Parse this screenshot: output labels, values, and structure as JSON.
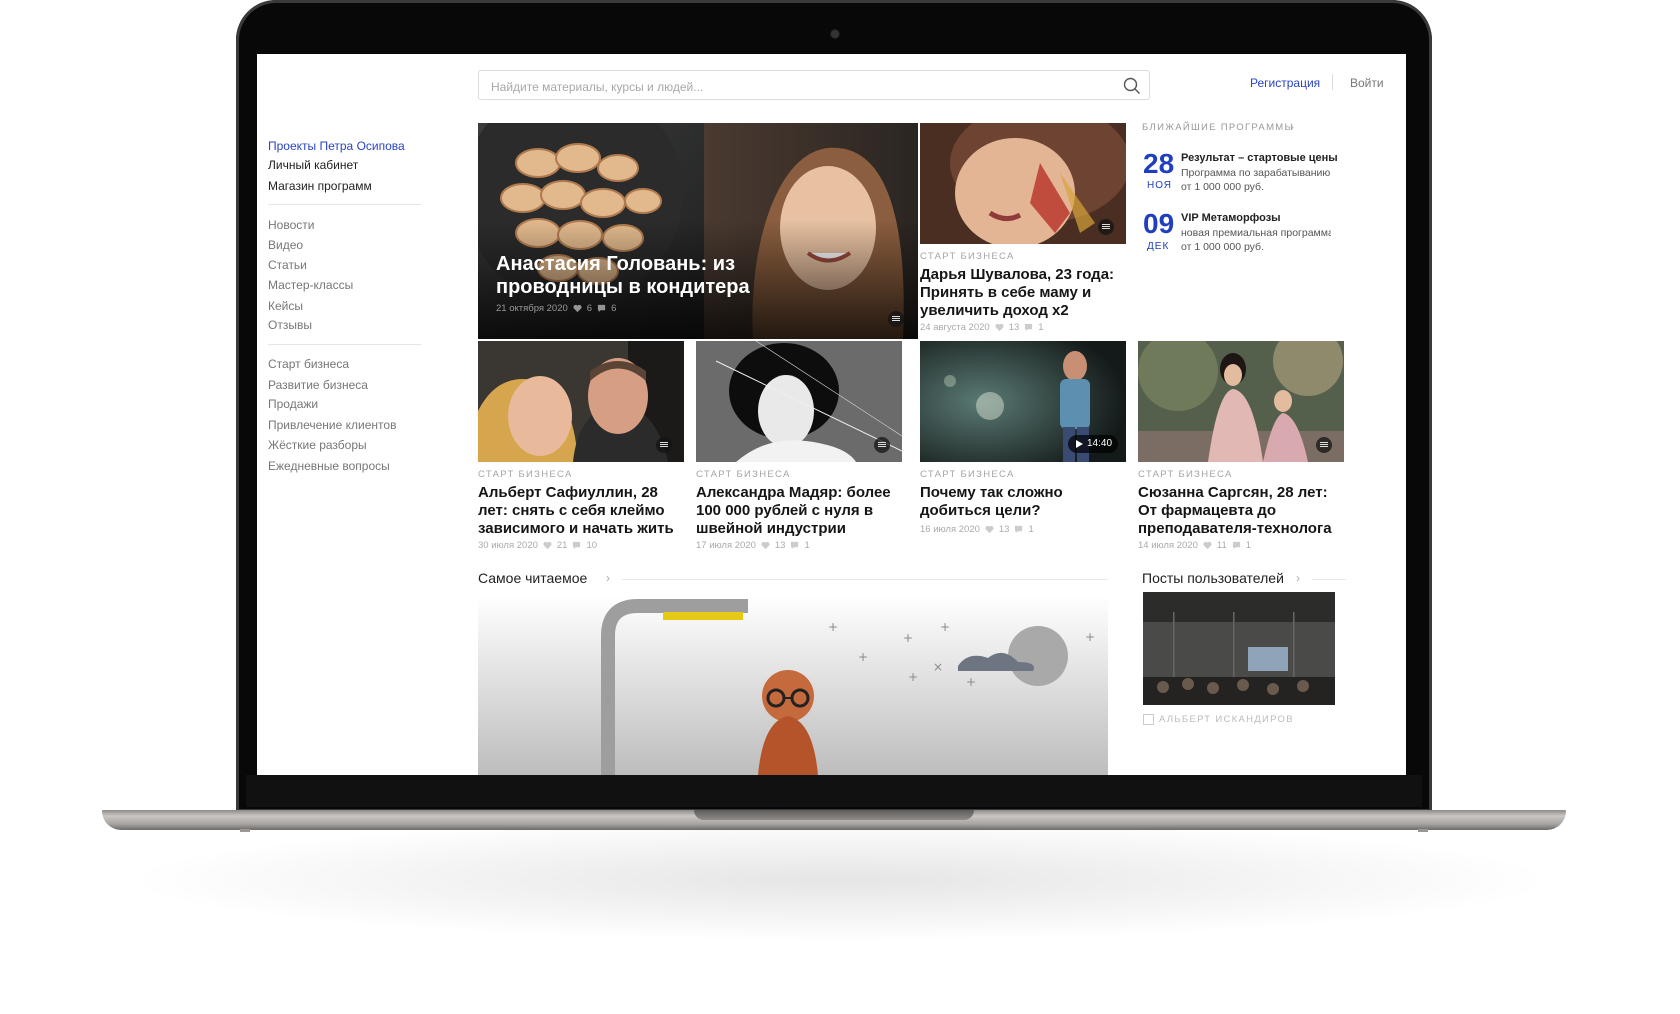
{
  "header": {
    "search_placeholder": "Найдите материалы, курсы и людей...",
    "register_label": "Регистрация",
    "login_label": "Войти"
  },
  "sidebar": {
    "top_items": [
      {
        "label": "Проекты Петра Осипова"
      },
      {
        "label": "Личный кабинет"
      },
      {
        "label": "Магазин программ"
      }
    ],
    "content_items": [
      {
        "label": "Новости"
      },
      {
        "label": "Видео"
      },
      {
        "label": "Статьи"
      },
      {
        "label": "Мастер-классы"
      },
      {
        "label": "Кейсы"
      },
      {
        "label": "Отзывы"
      }
    ],
    "topic_items": [
      {
        "label": "Старт бизнеса"
      },
      {
        "label": "Развитие бизнеса"
      },
      {
        "label": "Продажи"
      },
      {
        "label": "Привлечение клиентов"
      },
      {
        "label": "Жёсткие разборы"
      },
      {
        "label": "Ежедневные вопросы"
      }
    ]
  },
  "featured": {
    "title": "Анастасия Головань: из проводницы в кондитера",
    "date": "21 октября 2020",
    "likes": "6",
    "comments": "6"
  },
  "article_top_right": {
    "category": "СТАРТ БИЗНЕСА",
    "title": "Дарья Шувалова, 23 года: Принять в себе маму и увеличить доход х2",
    "date": "24 августа 2020",
    "likes": "13",
    "comments": "1"
  },
  "upcoming": {
    "header": "БЛИЖАЙШИЕ ПРОГРАММЫ",
    "programs": [
      {
        "day": "28",
        "month": "НОЯ",
        "title": "Результат – стартовые цены",
        "desc_line1": "Программа по зарабатыванию",
        "desc_line2": "от 1 000 000 руб."
      },
      {
        "day": "09",
        "month": "ДЕК",
        "title": "VIP Метаморфозы",
        "desc_line1": "новая премиальная программа",
        "desc_line2": "от 1 000 000 руб."
      }
    ]
  },
  "articles_row": [
    {
      "category": "СТАРТ БИЗНЕСА",
      "title": "Альберт Сафиуллин, 28 лет: снять с себя клеймо зависимого и начать жить",
      "date": "30 июля 2020",
      "likes": "21",
      "comments": "10"
    },
    {
      "category": "СТАРТ БИЗНЕСА",
      "title": "Александра Мадяр: более 100 000 рублей с нуля в швейной индустрии",
      "date": "17 июля 2020",
      "likes": "13",
      "comments": "1"
    },
    {
      "category": "СТАРТ БИЗНЕСА",
      "title": "Почему так сложно добиться цели?",
      "date": "16 июля 2020",
      "likes": "13",
      "comments": "1",
      "video_duration": "14:40"
    },
    {
      "category": "СТАРТ БИЗНЕСА",
      "title": "Сюзанна Саргсян, 28 лет: От фармацевта до преподавателя-технолога",
      "date": "14 июля 2020",
      "likes": "11",
      "comments": "1"
    }
  ],
  "sections": {
    "most_read": "Самое читаемое",
    "user_posts": "Посты пользователей"
  },
  "user_post": {
    "author": "АЛЬБЕРТ ИСКАНДИРОВ"
  },
  "colors": {
    "accent_blue": "#2a44c4",
    "date_blue": "#1f3fbf"
  }
}
